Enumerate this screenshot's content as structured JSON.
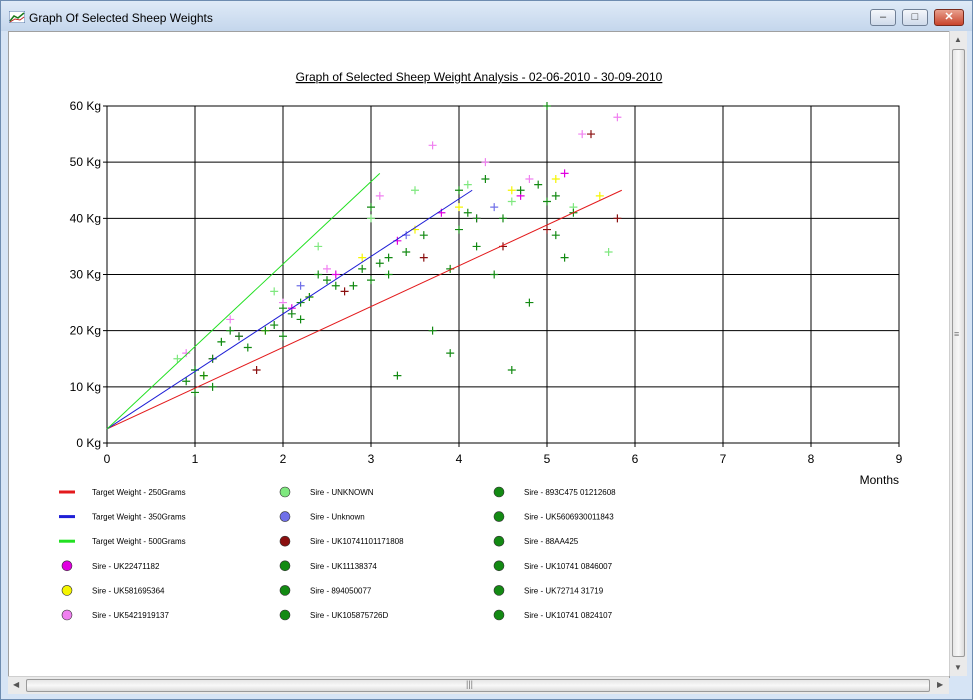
{
  "window": {
    "title": "Graph Of Selected Sheep Weights",
    "minimize": "–",
    "maximize": "□",
    "close": "✕"
  },
  "chart_data": {
    "type": "scatter",
    "title": "Graph of Selected Sheep Weight Analysis - 02-06-2010 - 30-09-2010",
    "xlabel": "Months",
    "ylabel": "",
    "xlim": [
      0,
      9
    ],
    "ylim": [
      0,
      60
    ],
    "x_ticks": [
      "0",
      "1",
      "2",
      "3",
      "4",
      "5",
      "6",
      "7",
      "8",
      "9"
    ],
    "y_ticks": [
      "0 Kg",
      "10 Kg",
      "20 Kg",
      "30 Kg",
      "40 Kg",
      "50 Kg",
      "60 Kg"
    ],
    "grid": true,
    "lines": [
      {
        "name": "Target Weight - 250Grams",
        "color": "#e31a1c",
        "x": [
          0,
          5.85
        ],
        "y": [
          2.5,
          45
        ]
      },
      {
        "name": "Target Weight - 350Grams",
        "color": "#1f1fd6",
        "x": [
          0,
          4.15
        ],
        "y": [
          2.5,
          45
        ]
      },
      {
        "name": "Target Weight - 500Grams",
        "color": "#22e022",
        "x": [
          0,
          3.1
        ],
        "y": [
          2.5,
          48
        ]
      }
    ],
    "series": [
      {
        "name": "Sire - UK22471182",
        "color": "#e000e0",
        "x": [
          1.2,
          1.5,
          2.1,
          2.6,
          3.3,
          3.8,
          4.2,
          4.7,
          5.2
        ],
        "y": [
          15,
          19,
          24,
          30,
          36,
          41,
          40,
          44,
          48
        ]
      },
      {
        "name": "Sire - UK581695364",
        "color": "#f5f500",
        "x": [
          1.1,
          1.8,
          2.3,
          2.9,
          3.5,
          4.0,
          4.6,
          5.1,
          5.6
        ],
        "y": [
          12,
          20,
          26,
          33,
          38,
          42,
          45,
          47,
          44
        ]
      },
      {
        "name": "Sire - UK5421919137",
        "color": "#f080f0",
        "x": [
          0.9,
          1.4,
          2.0,
          2.5,
          3.1,
          3.7,
          4.3,
          4.8,
          5.4,
          5.8
        ],
        "y": [
          16,
          22,
          25,
          31,
          44,
          53,
          50,
          47,
          55,
          58
        ]
      },
      {
        "name": "Sire - UNKNOWN",
        "color": "#7fe87f",
        "x": [
          0.8,
          1.3,
          1.9,
          2.4,
          3.0,
          3.5,
          4.1,
          4.6,
          5.3,
          5.7
        ],
        "y": [
          15,
          18,
          27,
          35,
          40,
          45,
          46,
          43,
          42,
          34
        ]
      },
      {
        "name": "Sire - Unknown",
        "color": "#7070e8",
        "x": [
          1.0,
          2.2,
          3.4,
          4.4
        ],
        "y": [
          13,
          28,
          37,
          42
        ]
      },
      {
        "name": "Sire - UK10741101171808",
        "color": "#8a0f0f",
        "x": [
          1.7,
          2.7,
          3.6,
          4.5,
          5.0,
          5.5,
          5.8
        ],
        "y": [
          13,
          27,
          33,
          35,
          38,
          55,
          40
        ]
      },
      {
        "name": "Sire - UK11138374",
        "color": "#138a13",
        "x": [
          1.0,
          1.6,
          2.2,
          2.8,
          3.4,
          4.0,
          4.5,
          5.0
        ],
        "y": [
          9,
          17,
          22,
          28,
          34,
          38,
          40,
          43
        ]
      },
      {
        "name": "Sire - 894050077",
        "color": "#138a13",
        "x": [
          1.1,
          1.8,
          2.5,
          3.2,
          3.9,
          4.4,
          4.9
        ],
        "y": [
          12,
          20,
          29,
          33,
          16,
          30,
          46
        ]
      },
      {
        "name": "Sire - UK105875726D",
        "color": "#138a13",
        "x": [
          1.2,
          2.0,
          2.9,
          3.7,
          4.2,
          4.7,
          5.3
        ],
        "y": [
          15,
          24,
          31,
          20,
          35,
          45,
          41
        ]
      },
      {
        "name": "Sire - 893C475 01212608",
        "color": "#138a13",
        "x": [
          1.3,
          2.1,
          3.0,
          3.9,
          4.8
        ],
        "y": [
          18,
          23,
          29,
          31,
          25
        ]
      },
      {
        "name": "Sire - UK5606930011843",
        "color": "#138a13",
        "x": [
          1.4,
          2.3,
          3.1,
          4.1,
          5.1
        ],
        "y": [
          20,
          26,
          32,
          41,
          37
        ]
      },
      {
        "name": "Sire - 88AA425",
        "color": "#138a13",
        "x": [
          1.5,
          2.4,
          3.3,
          4.3,
          5.0
        ],
        "y": [
          19,
          30,
          12,
          47,
          60
        ]
      },
      {
        "name": "Sire - UK10741 0846007",
        "color": "#138a13",
        "x": [
          0.9,
          1.9,
          2.6,
          3.6,
          4.6
        ],
        "y": [
          11,
          21,
          28,
          37,
          13
        ]
      },
      {
        "name": "Sire - UK72714 31719",
        "color": "#138a13",
        "x": [
          1.2,
          2.0,
          3.0,
          4.0,
          5.2
        ],
        "y": [
          10,
          19,
          42,
          45,
          33
        ]
      },
      {
        "name": "Sire - UK10741 0824107",
        "color": "#138a13",
        "x": [
          1.0,
          2.2,
          3.2,
          4.2,
          5.1
        ],
        "y": [
          13,
          25,
          30,
          40,
          44
        ]
      }
    ],
    "legend": {
      "placement": "bottom",
      "items": [
        {
          "label": "Target Weight - 250Grams",
          "kind": "line",
          "color": "#e31a1c"
        },
        {
          "label": "Target Weight - 350Grams",
          "kind": "line",
          "color": "#1f1fd6"
        },
        {
          "label": "Target Weight - 500Grams",
          "kind": "line",
          "color": "#22e022"
        },
        {
          "label": "Sire - UK22471182",
          "kind": "dot",
          "color": "#e000e0"
        },
        {
          "label": "Sire - UK581695364",
          "kind": "dot",
          "color": "#f5f500"
        },
        {
          "label": "Sire - UK5421919137",
          "kind": "dot",
          "color": "#f080f0"
        },
        {
          "label": "Sire - UNKNOWN",
          "kind": "dot",
          "color": "#7fe87f"
        },
        {
          "label": "Sire - Unknown",
          "kind": "dot",
          "color": "#7070e8"
        },
        {
          "label": "Sire - UK10741101171808",
          "kind": "dot",
          "color": "#8a0f0f"
        },
        {
          "label": "Sire - UK11138374",
          "kind": "dot",
          "color": "#138a13"
        },
        {
          "label": "Sire - 894050077",
          "kind": "dot",
          "color": "#138a13"
        },
        {
          "label": "Sire - UK105875726D",
          "kind": "dot",
          "color": "#138a13"
        },
        {
          "label": "Sire - 893C475 01212608",
          "kind": "dot",
          "color": "#138a13"
        },
        {
          "label": "Sire - UK5606930011843",
          "kind": "dot",
          "color": "#138a13"
        },
        {
          "label": "Sire - 88AA425",
          "kind": "dot",
          "color": "#138a13"
        },
        {
          "label": "Sire - UK10741 0846007",
          "kind": "dot",
          "color": "#138a13"
        },
        {
          "label": "Sire - UK72714 31719",
          "kind": "dot",
          "color": "#138a13"
        },
        {
          "label": "Sire - UK10741 0824107",
          "kind": "dot",
          "color": "#138a13"
        }
      ]
    }
  }
}
